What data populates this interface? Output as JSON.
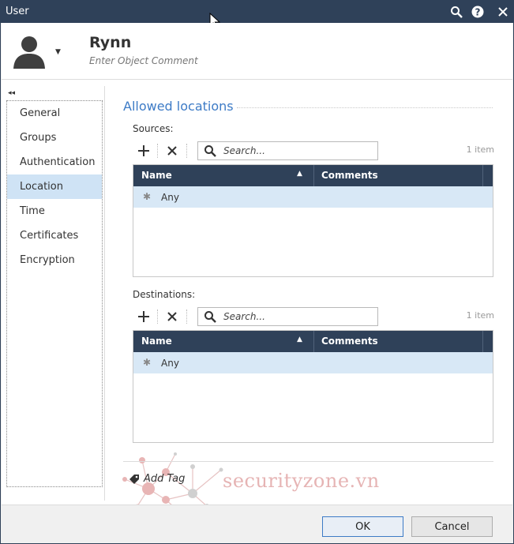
{
  "window": {
    "title": "User"
  },
  "header": {
    "name": "Rynn",
    "comment_placeholder": "Enter Object Comment"
  },
  "nav": {
    "items": [
      {
        "label": "General"
      },
      {
        "label": "Groups"
      },
      {
        "label": "Authentication"
      },
      {
        "label": "Location",
        "active": true
      },
      {
        "label": "Time"
      },
      {
        "label": "Certificates"
      },
      {
        "label": "Encryption"
      }
    ]
  },
  "section": {
    "title": "Allowed locations"
  },
  "sources": {
    "label": "Sources:",
    "search_placeholder": "Search...",
    "count": "1 item",
    "columns": {
      "name": "Name",
      "comments": "Comments"
    },
    "rows": [
      {
        "name": "Any",
        "comments": ""
      }
    ]
  },
  "destinations": {
    "label": "Destinations:",
    "search_placeholder": "Search...",
    "count": "1 item",
    "columns": {
      "name": "Name",
      "comments": "Comments"
    },
    "rows": [
      {
        "name": "Any",
        "comments": ""
      }
    ]
  },
  "tags": {
    "add_label": "Add Tag"
  },
  "footer": {
    "ok_label": "OK",
    "cancel_label": "Cancel"
  },
  "watermark": {
    "text": "securityzone.vn"
  },
  "colors": {
    "titlebar": "#2f4159",
    "accent": "#3d7bc6",
    "selected_row": "#d8e8f6",
    "nav_active": "#cfe3f5"
  }
}
